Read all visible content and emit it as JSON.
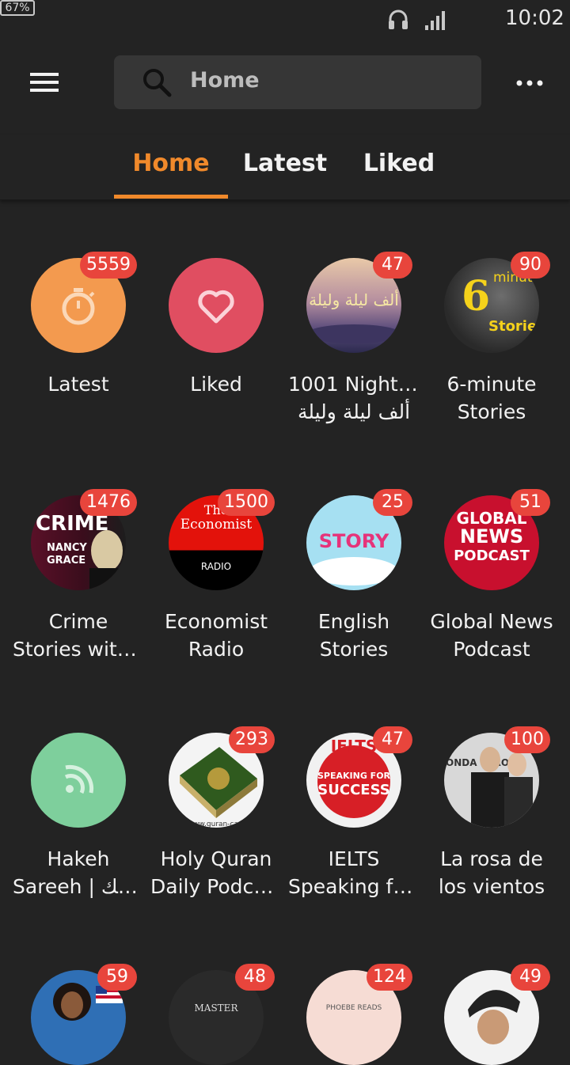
{
  "status_bar": {
    "battery": "67%",
    "time": "10:02"
  },
  "search": {
    "text": "Home"
  },
  "tabs": [
    {
      "label": "Home",
      "active": true
    },
    {
      "label": "Latest",
      "active": false
    },
    {
      "label": "Liked",
      "active": false
    }
  ],
  "colors": {
    "accent": "#f0892b",
    "badge": "#e8453c",
    "background": "#232323"
  },
  "grid": [
    {
      "line1": "Latest",
      "line2": "",
      "badge": "5559",
      "art": "stopwatch"
    },
    {
      "line1": "Liked",
      "line2": "",
      "badge": "",
      "art": "heart"
    },
    {
      "line1": "1001 Nights |",
      "line2": "ألف ليلة وليلة",
      "badge": "47",
      "art": "nights",
      "art_text": "ألف ليلة وليلة"
    },
    {
      "line1": "6-minute",
      "line2": "Stories",
      "badge": "90",
      "art": "six-minute",
      "art_text_a": "6",
      "art_text_b": "minute",
      "art_text_c": "Stories"
    },
    {
      "line1": "Crime",
      "line2": "Stories with…",
      "badge": "1476",
      "art": "crime",
      "art_text_a": "CRIME",
      "art_text_b": "NANCY",
      "art_text_c": "GRACE"
    },
    {
      "line1": "Economist",
      "line2": "Radio",
      "badge": "1500",
      "art": "economist",
      "art_text_a": "The",
      "art_text_b": "Economist",
      "art_text_c": "RADIO"
    },
    {
      "line1": "English",
      "line2": "Stories",
      "badge": "25",
      "art": "story",
      "art_text_a": "STORY"
    },
    {
      "line1": "Global News",
      "line2": "Podcast",
      "badge": "51",
      "art": "global-news",
      "art_text_a": "GLOBAL",
      "art_text_b": "NEWS",
      "art_text_c": "PODCAST"
    },
    {
      "line1": "Hakeh",
      "line2": "Sareeh | حك…",
      "badge": "",
      "art": "rss"
    },
    {
      "line1": "Holy Quran",
      "line2": "Daily Podcast",
      "badge": "293",
      "art": "quran",
      "art_text_a": "www.guran-cast"
    },
    {
      "line1": "IELTS",
      "line2": "Speaking fo…",
      "badge": "47",
      "art": "ielts",
      "art_text_a": "IELTS",
      "art_text_b": "SPEAKING FOR",
      "art_text_c": "SUCCESS"
    },
    {
      "line1": "La rosa de",
      "line2": "los vientos",
      "badge": "100",
      "art": "la-rosa",
      "art_text_a": "ONDA CERO"
    },
    {
      "line1": "",
      "line2": "",
      "badge": "59",
      "art": "usa-woman"
    },
    {
      "line1": "",
      "line2": "",
      "badge": "48",
      "art": "master",
      "art_text_a": "MASTER"
    },
    {
      "line1": "",
      "line2": "",
      "badge": "124",
      "art": "phoebe",
      "art_text_a": "PHOEBE READS"
    },
    {
      "line1": "",
      "line2": "",
      "badge": "49",
      "art": "man-hat"
    }
  ]
}
